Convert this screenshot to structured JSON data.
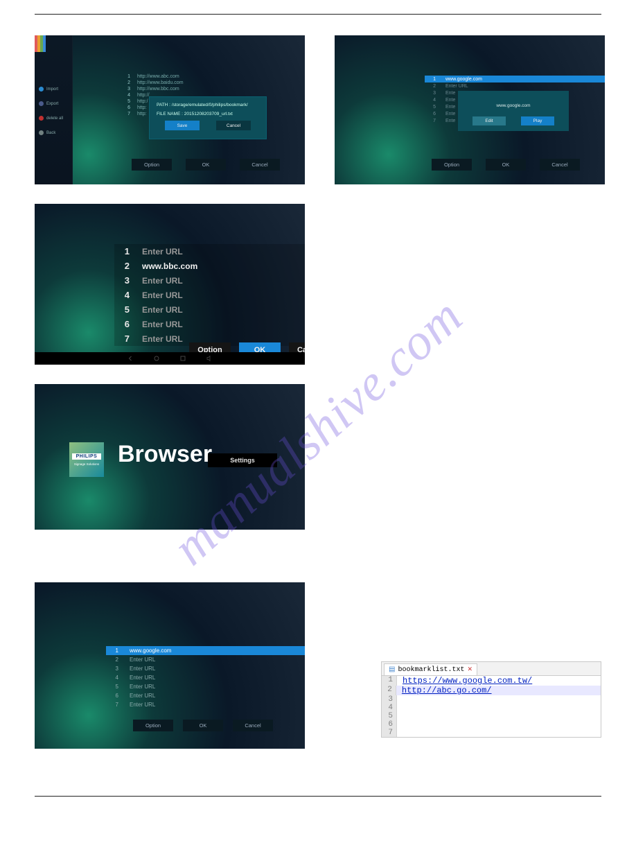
{
  "watermark": "manualshive.com",
  "shot1": {
    "sidebar": [
      {
        "label": "Import",
        "color": "#2a8ad0"
      },
      {
        "label": "Export",
        "color": "#4a5a8a"
      },
      {
        "label": "delete all",
        "color": "#c03030"
      },
      {
        "label": "Back",
        "color": "#708080"
      }
    ],
    "urls": [
      "http://www.abc.com",
      "http://www.baidu.com",
      "http://www.bbc.com",
      "http://",
      "http:/",
      "http:",
      "http:"
    ],
    "modal": {
      "path_label": "PATH : /storage/emulated/0/philips/bookmark/",
      "file_label": "FILE NAME : 20151208203709_url.txt",
      "save": "Save",
      "cancel": "Cancel"
    },
    "footer": {
      "option": "Option",
      "ok": "OK",
      "cancel": "Cancel"
    }
  },
  "shot2": {
    "rows": [
      {
        "n": "1",
        "t": "Enter URL"
      },
      {
        "n": "2",
        "t": "www.bbc.com",
        "filled": true
      },
      {
        "n": "3",
        "t": "Enter URL"
      },
      {
        "n": "4",
        "t": "Enter URL"
      },
      {
        "n": "5",
        "t": "Enter URL"
      },
      {
        "n": "6",
        "t": "Enter URL"
      },
      {
        "n": "7",
        "t": "Enter URL"
      }
    ],
    "btns": {
      "option": "Option",
      "ok": "OK",
      "cancel": "Cancel"
    }
  },
  "shot3": {
    "brand": "PHILIPS",
    "brand_sub": "Signage Solutions",
    "title": "Browser",
    "settings": "Settings"
  },
  "shot4": {
    "rows": [
      {
        "n": "1",
        "t": "www.google.com",
        "sel": true
      },
      {
        "n": "2",
        "t": "Enter URL"
      },
      {
        "n": "3",
        "t": "Enter URL"
      },
      {
        "n": "4",
        "t": "Enter URL"
      },
      {
        "n": "5",
        "t": "Enter URL"
      },
      {
        "n": "6",
        "t": "Enter URL"
      },
      {
        "n": "7",
        "t": "Enter URL"
      }
    ],
    "footer": {
      "option": "Option",
      "ok": "OK",
      "cancel": "Cancel"
    }
  },
  "shot5": {
    "rows": [
      {
        "n": "1",
        "t": "www.google.com",
        "sel": true
      },
      {
        "n": "2",
        "t": "Enter URL"
      },
      {
        "n": "3",
        "t": "Ente"
      },
      {
        "n": "4",
        "t": "Ente"
      },
      {
        "n": "5",
        "t": "Ente"
      },
      {
        "n": "6",
        "t": "Ente"
      },
      {
        "n": "7",
        "t": "Ente"
      }
    ],
    "popup": {
      "label": "www.google.com",
      "edit": "Edit",
      "play": "Play"
    },
    "footer": {
      "option": "Option",
      "ok": "OK",
      "cancel": "Cancel"
    }
  },
  "notepad": {
    "tab": "bookmarklist.txt",
    "lines": [
      "https://www.google.com.tw/",
      "http://abc.go.com/",
      "",
      "",
      "",
      "",
      ""
    ]
  }
}
